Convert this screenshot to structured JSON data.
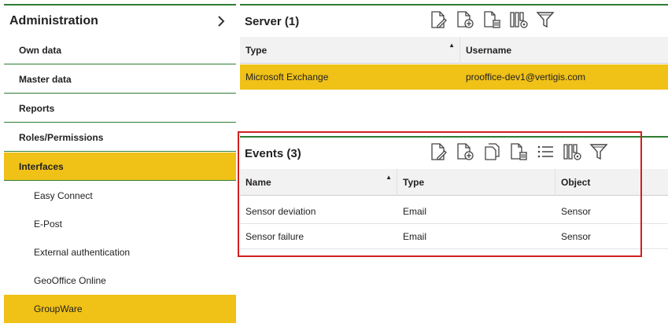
{
  "sidebar": {
    "title": "Administration",
    "items": [
      {
        "label": "Own data"
      },
      {
        "label": "Master data"
      },
      {
        "label": "Reports"
      },
      {
        "label": "Roles/Permissions"
      },
      {
        "label": "Interfaces"
      }
    ],
    "subitems": [
      {
        "label": "Easy Connect"
      },
      {
        "label": "E-Post"
      },
      {
        "label": "External authentication"
      },
      {
        "label": "GeoOffice Online"
      },
      {
        "label": "GroupWare"
      }
    ]
  },
  "server": {
    "title": "Server (1)",
    "columns": [
      "Type",
      "Username"
    ],
    "rows": [
      {
        "type": "Microsoft Exchange",
        "username": "prooffice-dev1@vertigis.com"
      }
    ]
  },
  "events": {
    "title": "Events (3)",
    "columns": [
      "Name",
      "Type",
      "Object"
    ],
    "rows": [
      {
        "name": "Sensor deviation",
        "type": "Email",
        "object": "Sensor"
      },
      {
        "name": "Sensor failure",
        "type": "Email",
        "object": "Sensor"
      }
    ]
  },
  "colors": {
    "accent": "#f0c117",
    "line": "#2e7d32",
    "highlight": "#d21f1f"
  }
}
